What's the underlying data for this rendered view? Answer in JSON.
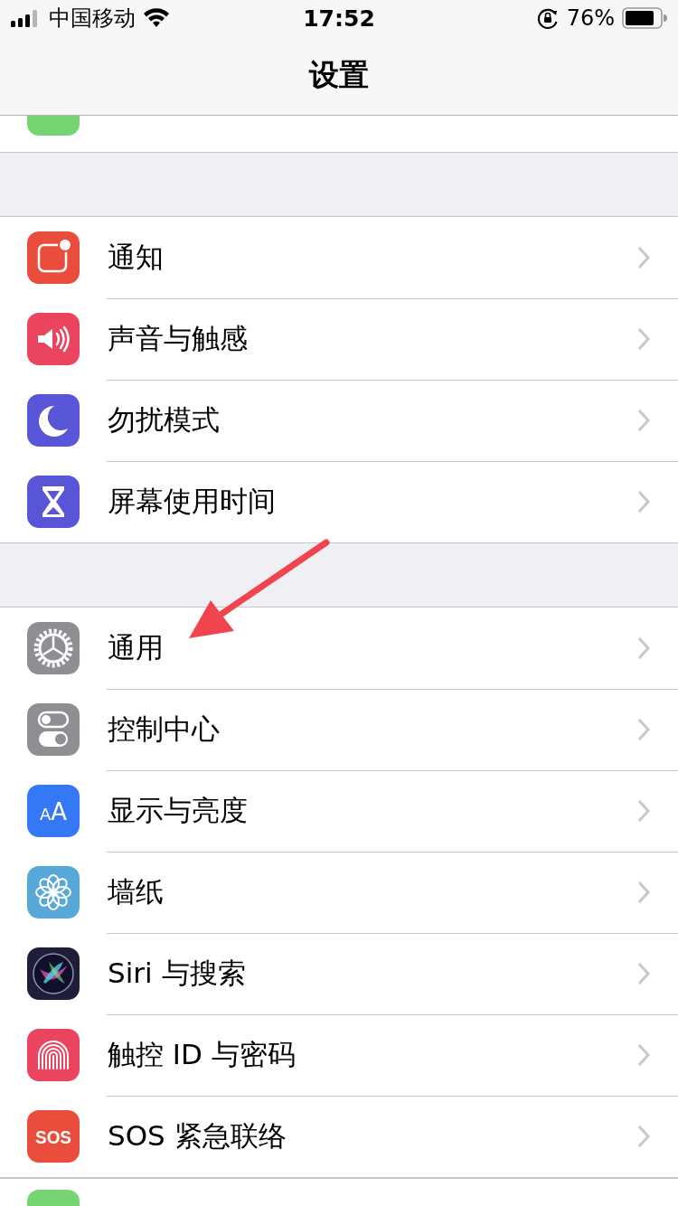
{
  "status_bar": {
    "carrier": "中国移动",
    "time": "17:52",
    "battery": "76%"
  },
  "nav": {
    "title": "设置"
  },
  "top_partial_row": {
    "color": "#76d572"
  },
  "sections": [
    {
      "items": [
        {
          "kind": "notifications",
          "label": "通知",
          "color": "#eb4d3d"
        },
        {
          "kind": "sounds",
          "label": "声音与触感",
          "color": "#eb445f"
        },
        {
          "kind": "dnd",
          "label": "勿扰模式",
          "color": "#5856d6"
        },
        {
          "kind": "screentime",
          "label": "屏幕使用时间",
          "color": "#5856d6"
        }
      ]
    },
    {
      "items": [
        {
          "kind": "general",
          "label": "通用",
          "color": "#8e8e93"
        },
        {
          "kind": "control",
          "label": "控制中心",
          "color": "#8e8e93"
        },
        {
          "kind": "display",
          "label": "显示与亮度",
          "color": "#3478f6",
          "icon_text": "AA"
        },
        {
          "kind": "wallpaper",
          "label": "墙纸",
          "color": "#57a8d9"
        },
        {
          "kind": "siri",
          "label": "Siri 与搜索",
          "color": "#1e1e3a"
        },
        {
          "kind": "touchid",
          "label": "触控 ID 与密码",
          "color": "#eb445f"
        },
        {
          "kind": "sos",
          "label": "SOS 紧急联络",
          "color": "#eb4d3d",
          "icon_text": "SOS"
        }
      ]
    }
  ],
  "bottom_partial_row": {
    "color": "#76d572"
  }
}
